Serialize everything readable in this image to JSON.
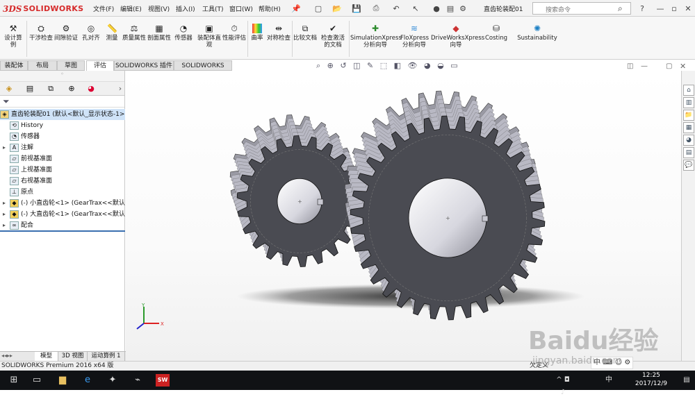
{
  "app": {
    "logo_prefix": "3DS",
    "logo_text": "SOLIDWORKS",
    "document_title": "直齿轮装配01",
    "search_placeholder": "搜索命令"
  },
  "menu": [
    "文件(F)",
    "编辑(E)",
    "视图(V)",
    "插入(I)",
    "工具(T)",
    "窗口(W)",
    "帮助(H)"
  ],
  "commands": [
    {
      "label": "设计算例",
      "icon": "design-study-icon"
    },
    {
      "label": "干涉检查",
      "icon": "interference-icon"
    },
    {
      "label": "间隙验证",
      "icon": "clearance-icon"
    },
    {
      "label": "孔对齐",
      "icon": "hole-align-icon"
    },
    {
      "label": "测量",
      "icon": "measure-icon"
    },
    {
      "label": "质量属性",
      "icon": "mass-properties-icon"
    },
    {
      "label": "剖面属性",
      "icon": "section-properties-icon"
    },
    {
      "label": "传感器",
      "icon": "sensor-icon"
    },
    {
      "label": "装配体直观",
      "icon": "assembly-visualization-icon"
    },
    {
      "label": "性能评估",
      "icon": "performance-icon"
    },
    {
      "label": "曲率",
      "icon": "curvature-icon"
    },
    {
      "label": "对称检查",
      "icon": "symmetry-check-icon"
    },
    {
      "label": "比较文档",
      "icon": "compare-documents-icon"
    },
    {
      "label": "检查激活的文档",
      "icon": "check-document-icon"
    },
    {
      "label": "SimulationXpress 分析向导",
      "icon": "simulationxpress-icon"
    },
    {
      "label": "FloXpress 分析向导",
      "icon": "floxpress-icon"
    },
    {
      "label": "DriveWorksXpress 向导",
      "icon": "driveworksxpress-icon"
    },
    {
      "label": "Costing",
      "icon": "costing-icon"
    },
    {
      "label": "Sustainability",
      "icon": "sustainability-icon"
    }
  ],
  "tabs": [
    "装配体",
    "布局",
    "草图",
    "评估",
    "SOLIDWORKS 插件",
    "SOLIDWORKS MBD"
  ],
  "tree": {
    "root": "直齿轮装配01  (默认<默认_显示状态-1>)",
    "items": [
      {
        "label": "History",
        "icon": "history-icon"
      },
      {
        "label": "传感器",
        "icon": "sensor-icon"
      },
      {
        "label": "注解",
        "icon": "annotation-icon"
      },
      {
        "label": "前视基准面",
        "icon": "plane-icon"
      },
      {
        "label": "上视基准面",
        "icon": "plane-icon"
      },
      {
        "label": "右视基准面",
        "icon": "plane-icon"
      },
      {
        "label": "原点",
        "icon": "origin-icon"
      },
      {
        "label": "(-) 小直齿轮<1> (GearTrax<<默认",
        "icon": "part-icon"
      },
      {
        "label": "(-) 大直齿轮<1> (GearTrax<<默认",
        "icon": "part-icon"
      },
      {
        "label": "配合",
        "icon": "mates-icon"
      }
    ]
  },
  "bottom_tabs": [
    "模型",
    "3D 视图",
    "运动算例 1"
  ],
  "status_text": "SOLIDWORKS Premium 2016 x64 版",
  "status_right": "欠定义",
  "taskbar": {
    "time": "12:25",
    "date": "2017/12/9",
    "ime": "中"
  },
  "watermark": {
    "big": "Baidu经验",
    "small": "jingyan.baidu.com"
  }
}
